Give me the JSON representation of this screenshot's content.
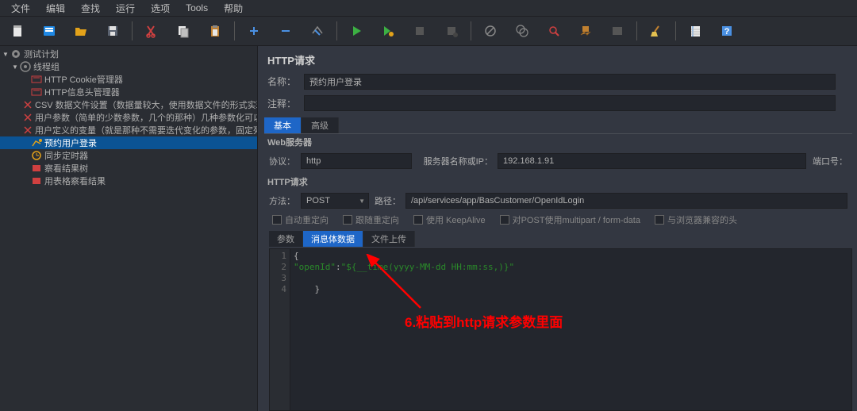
{
  "menu": {
    "items": [
      "文件",
      "编辑",
      "查找",
      "运行",
      "选项",
      "Tools",
      "帮助"
    ]
  },
  "tree": {
    "root": "测试计划",
    "group": "线程组",
    "items": [
      "HTTP Cookie管理器",
      "HTTP信息头管理器",
      "CSV 数据文件设置（数据量较大，使用数据文件的形式实现）",
      "用户参数（简单的少数参数，几个的那种）几种参数化可以联合",
      "用户定义的变量（就是那种不需要迭代变化的参数，固定死的）",
      "预约用户登录",
      "同步定时器",
      "察看结果树",
      "用表格察看结果"
    ]
  },
  "panel": {
    "title": "HTTP请求",
    "name_label": "名称：",
    "name_value": "预约用户登录",
    "comment_label": "注释：",
    "tabs": {
      "basic": "基本",
      "advanced": "高级"
    },
    "web_server_title": "Web服务器",
    "protocol_label": "协议：",
    "protocol_value": "http",
    "server_label": "服务器名称或IP：",
    "server_value": "192.168.1.91",
    "port_label": "端口号：",
    "http_request_title": "HTTP请求",
    "method_label": "方法：",
    "method_value": "POST",
    "path_label": "路径：",
    "path_value": "/api/services/app/BasCustomer/OpenIdLogin",
    "checkboxes": {
      "auto_redirect": "自动重定向",
      "follow_redirect": "跟随重定向",
      "keepalive": "使用 KeepAlive",
      "multipart": "对POST使用multipart / form-data",
      "browser_headers": "与浏览器兼容的头"
    },
    "body_tabs": {
      "params": "参数",
      "body": "消息体数据",
      "files": "文件上传"
    },
    "editor": {
      "lines": [
        "1",
        "2",
        "3",
        "4"
      ],
      "l1": "{",
      "l2_key": "\"openId\"",
      "l2_sep": ":",
      "l2_val": "\"${__time(yyyy-MM-dd HH:mm:ss,)}\"",
      "l3": "",
      "l4": "    }"
    }
  },
  "annotation": "6.粘贴到http请求参数里面"
}
